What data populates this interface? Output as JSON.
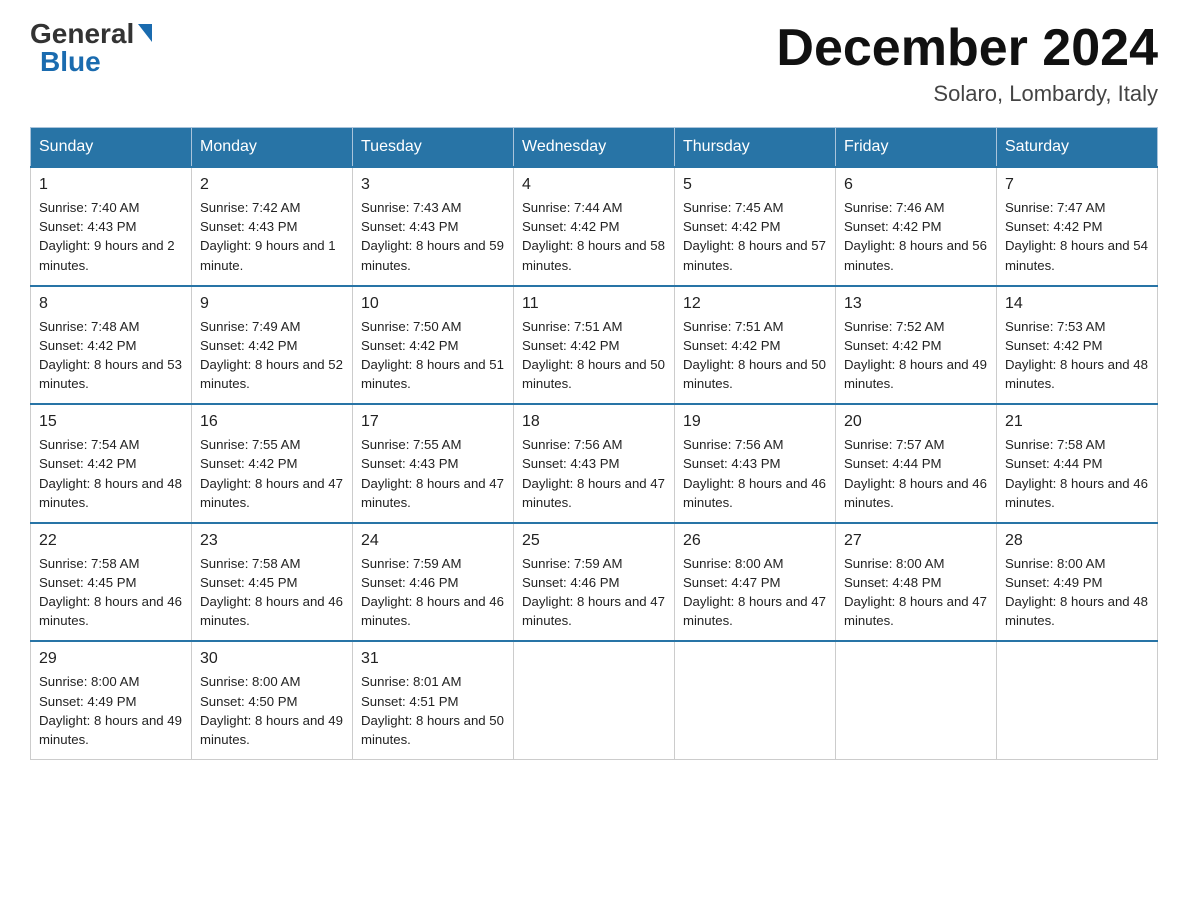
{
  "header": {
    "logo_general": "General",
    "logo_blue": "Blue",
    "month_title": "December 2024",
    "location": "Solaro, Lombardy, Italy"
  },
  "days_of_week": [
    "Sunday",
    "Monday",
    "Tuesday",
    "Wednesday",
    "Thursday",
    "Friday",
    "Saturday"
  ],
  "weeks": [
    [
      {
        "day": "1",
        "sunrise": "7:40 AM",
        "sunset": "4:43 PM",
        "daylight": "9 hours and 2 minutes."
      },
      {
        "day": "2",
        "sunrise": "7:42 AM",
        "sunset": "4:43 PM",
        "daylight": "9 hours and 1 minute."
      },
      {
        "day": "3",
        "sunrise": "7:43 AM",
        "sunset": "4:43 PM",
        "daylight": "8 hours and 59 minutes."
      },
      {
        "day": "4",
        "sunrise": "7:44 AM",
        "sunset": "4:42 PM",
        "daylight": "8 hours and 58 minutes."
      },
      {
        "day": "5",
        "sunrise": "7:45 AM",
        "sunset": "4:42 PM",
        "daylight": "8 hours and 57 minutes."
      },
      {
        "day": "6",
        "sunrise": "7:46 AM",
        "sunset": "4:42 PM",
        "daylight": "8 hours and 56 minutes."
      },
      {
        "day": "7",
        "sunrise": "7:47 AM",
        "sunset": "4:42 PM",
        "daylight": "8 hours and 54 minutes."
      }
    ],
    [
      {
        "day": "8",
        "sunrise": "7:48 AM",
        "sunset": "4:42 PM",
        "daylight": "8 hours and 53 minutes."
      },
      {
        "day": "9",
        "sunrise": "7:49 AM",
        "sunset": "4:42 PM",
        "daylight": "8 hours and 52 minutes."
      },
      {
        "day": "10",
        "sunrise": "7:50 AM",
        "sunset": "4:42 PM",
        "daylight": "8 hours and 51 minutes."
      },
      {
        "day": "11",
        "sunrise": "7:51 AM",
        "sunset": "4:42 PM",
        "daylight": "8 hours and 50 minutes."
      },
      {
        "day": "12",
        "sunrise": "7:51 AM",
        "sunset": "4:42 PM",
        "daylight": "8 hours and 50 minutes."
      },
      {
        "day": "13",
        "sunrise": "7:52 AM",
        "sunset": "4:42 PM",
        "daylight": "8 hours and 49 minutes."
      },
      {
        "day": "14",
        "sunrise": "7:53 AM",
        "sunset": "4:42 PM",
        "daylight": "8 hours and 48 minutes."
      }
    ],
    [
      {
        "day": "15",
        "sunrise": "7:54 AM",
        "sunset": "4:42 PM",
        "daylight": "8 hours and 48 minutes."
      },
      {
        "day": "16",
        "sunrise": "7:55 AM",
        "sunset": "4:42 PM",
        "daylight": "8 hours and 47 minutes."
      },
      {
        "day": "17",
        "sunrise": "7:55 AM",
        "sunset": "4:43 PM",
        "daylight": "8 hours and 47 minutes."
      },
      {
        "day": "18",
        "sunrise": "7:56 AM",
        "sunset": "4:43 PM",
        "daylight": "8 hours and 47 minutes."
      },
      {
        "day": "19",
        "sunrise": "7:56 AM",
        "sunset": "4:43 PM",
        "daylight": "8 hours and 46 minutes."
      },
      {
        "day": "20",
        "sunrise": "7:57 AM",
        "sunset": "4:44 PM",
        "daylight": "8 hours and 46 minutes."
      },
      {
        "day": "21",
        "sunrise": "7:58 AM",
        "sunset": "4:44 PM",
        "daylight": "8 hours and 46 minutes."
      }
    ],
    [
      {
        "day": "22",
        "sunrise": "7:58 AM",
        "sunset": "4:45 PM",
        "daylight": "8 hours and 46 minutes."
      },
      {
        "day": "23",
        "sunrise": "7:58 AM",
        "sunset": "4:45 PM",
        "daylight": "8 hours and 46 minutes."
      },
      {
        "day": "24",
        "sunrise": "7:59 AM",
        "sunset": "4:46 PM",
        "daylight": "8 hours and 46 minutes."
      },
      {
        "day": "25",
        "sunrise": "7:59 AM",
        "sunset": "4:46 PM",
        "daylight": "8 hours and 47 minutes."
      },
      {
        "day": "26",
        "sunrise": "8:00 AM",
        "sunset": "4:47 PM",
        "daylight": "8 hours and 47 minutes."
      },
      {
        "day": "27",
        "sunrise": "8:00 AM",
        "sunset": "4:48 PM",
        "daylight": "8 hours and 47 minutes."
      },
      {
        "day": "28",
        "sunrise": "8:00 AM",
        "sunset": "4:49 PM",
        "daylight": "8 hours and 48 minutes."
      }
    ],
    [
      {
        "day": "29",
        "sunrise": "8:00 AM",
        "sunset": "4:49 PM",
        "daylight": "8 hours and 49 minutes."
      },
      {
        "day": "30",
        "sunrise": "8:00 AM",
        "sunset": "4:50 PM",
        "daylight": "8 hours and 49 minutes."
      },
      {
        "day": "31",
        "sunrise": "8:01 AM",
        "sunset": "4:51 PM",
        "daylight": "8 hours and 50 minutes."
      },
      null,
      null,
      null,
      null
    ]
  ]
}
